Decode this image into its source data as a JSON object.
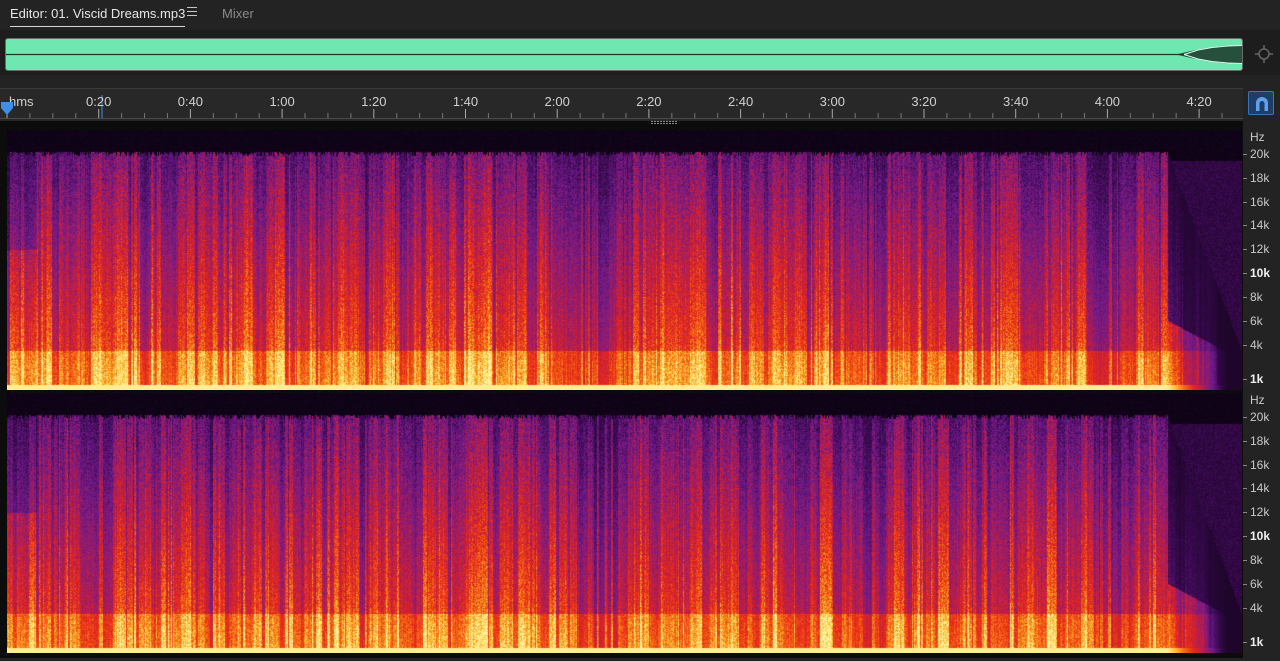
{
  "tabs": {
    "editor_label": "Editor: 01. Viscid Dreams.mp3",
    "mixer_label": "Mixer"
  },
  "ruler": {
    "unit_label": "hms",
    "time_labels": [
      "0:20",
      "0:40",
      "1:00",
      "1:20",
      "1:40",
      "2:00",
      "2:20",
      "2:40",
      "3:00",
      "3:20",
      "3:40",
      "4:00",
      "4:20"
    ]
  },
  "channels": [
    {
      "unit_label": "Hz",
      "freq_labels": [
        "20k",
        "18k",
        "16k",
        "14k",
        "12k",
        "10k",
        "8k",
        "6k",
        "4k",
        "1k"
      ]
    },
    {
      "unit_label": "Hz",
      "freq_labels": [
        "20k",
        "18k",
        "16k",
        "14k",
        "12k",
        "10k",
        "8k",
        "6k",
        "4k",
        "1k"
      ]
    }
  ],
  "colors": {
    "waveform_overview": "#6ee8b0",
    "playhead": "#3f8ee8",
    "spectral_hot": "#ffe060",
    "spectral_mid": "#e83018",
    "spectral_cool": "#6a1a8a"
  },
  "icons": {
    "menu": "hamburger-menu-icon",
    "zoom": "zoom-crosshair-icon",
    "snap": "magnet-snap-icon",
    "playhead": "playhead-marker-icon"
  }
}
